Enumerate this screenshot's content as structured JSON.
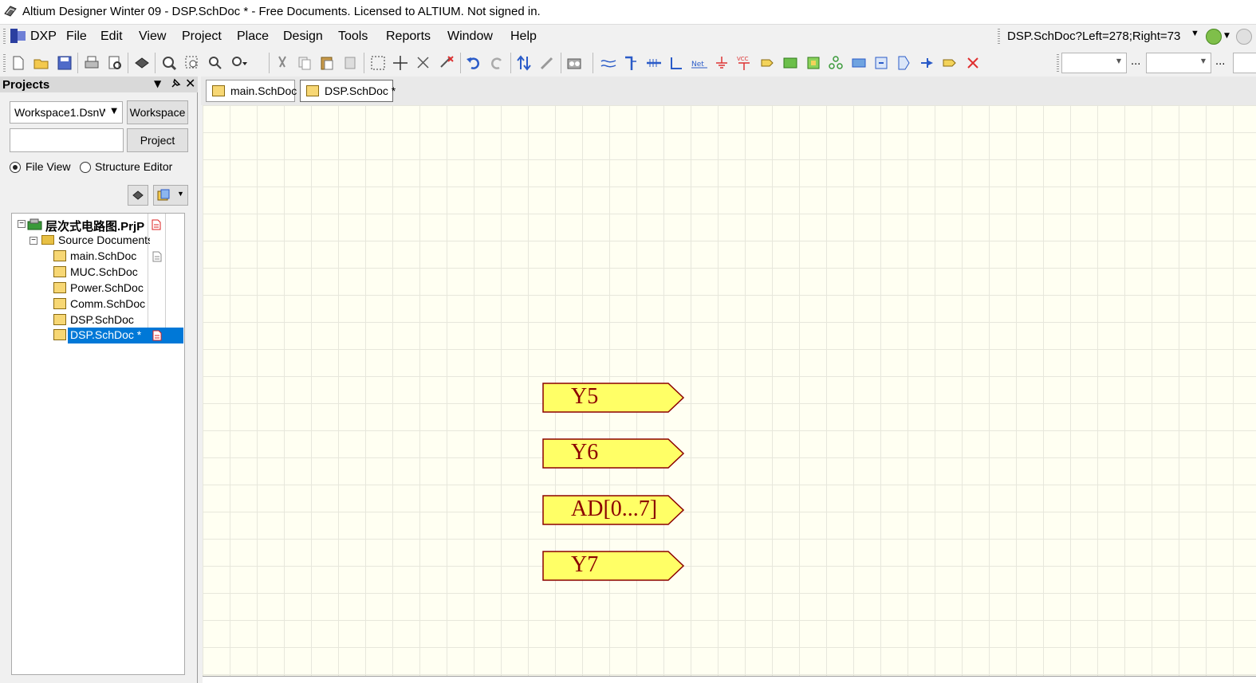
{
  "window": {
    "title": "Altium Designer Winter 09 - DSP.SchDoc * - Free Documents. Licensed to ALTIUM. Not signed in."
  },
  "menu": {
    "items": [
      {
        "label": "DXP"
      },
      {
        "label": "File"
      },
      {
        "label": "Edit"
      },
      {
        "label": "View"
      },
      {
        "label": "Project"
      },
      {
        "label": "Place"
      },
      {
        "label": "Design"
      },
      {
        "label": "Tools"
      },
      {
        "label": "Reports"
      },
      {
        "label": "Window"
      },
      {
        "label": "Help"
      }
    ],
    "address": "DSP.SchDoc?Left=278;Right=73"
  },
  "toolbar": {
    "dots1": "...",
    "dots2": "..."
  },
  "panel": {
    "title": "Projects",
    "workspace_value": "Workspace1.DsnW",
    "workspace_button": "Workspace",
    "project_input_value": "",
    "project_button": "Project",
    "view_options": [
      "File View",
      "Structure Editor"
    ],
    "selected_view": "File View",
    "tree": {
      "project": "层次式电路图.PrjP",
      "folder": "Source Documents",
      "documents": [
        {
          "name": "main.SchDoc"
        },
        {
          "name": "MUC.SchDoc"
        },
        {
          "name": "Power.SchDoc"
        },
        {
          "name": "Comm.SchDoc"
        },
        {
          "name": "DSP.SchDoc"
        },
        {
          "name": "DSP.SchDoc *"
        }
      ]
    }
  },
  "tabs": [
    {
      "label": "main.SchDoc"
    },
    {
      "label": "DSP.SchDoc *"
    }
  ],
  "schematic": {
    "ports": [
      {
        "label": "Y5"
      },
      {
        "label": "Y6"
      },
      {
        "label": "AD[0...7]"
      },
      {
        "label": "Y7"
      }
    ],
    "colors": {
      "sheet_background": "#fffff2",
      "port_fill": "#ffff66",
      "port_text": "#8b0000",
      "selection": "#0078d7"
    }
  }
}
